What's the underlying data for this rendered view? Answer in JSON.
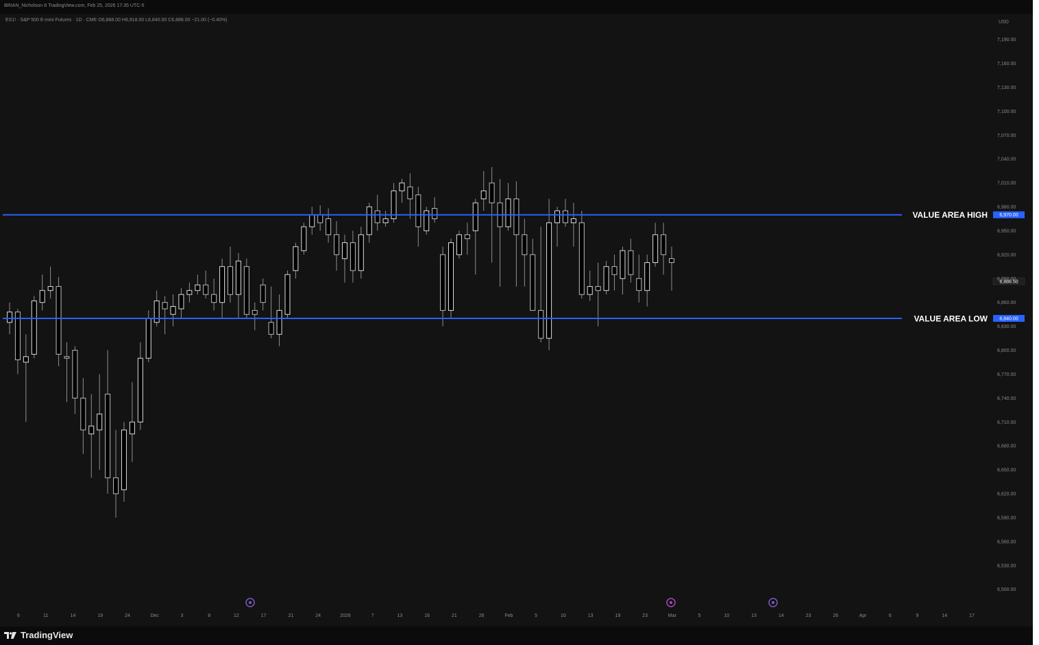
{
  "header": {
    "top_text": "BRIAN_Nicholson·6 TradingView.com, Feb 25, 2026 17:35 UTC-5",
    "legend_text": "ES1! · S&P 500 E-mini Futures · 1D · CME   O6,888.00  H6,918.00  L6,840.00  C6,888.00  −21.00 (−0.40%)"
  },
  "axis": {
    "currency": "USD"
  },
  "levels": [
    {
      "label": "VALUE AREA HIGH",
      "price": 6970.0,
      "tag": "6,970.00",
      "color": "#2962ff"
    },
    {
      "label": "VALUE AREA LOW",
      "price": 6840.0,
      "tag": "6,840.00",
      "color": "#2962ff"
    }
  ],
  "last_price_tag": "6,886.50",
  "markers": [
    {
      "type": "event",
      "x_index": 0,
      "color": "#7e57c2",
      "glyph": "E"
    },
    {
      "type": "event",
      "x_index": 1,
      "color": "#ab47bc",
      "glyph": "D"
    },
    {
      "type": "event",
      "x_index": 2,
      "color": "#7e57c2",
      "glyph": "E"
    }
  ],
  "footer": {
    "brand": "TradingView"
  },
  "chart_data": {
    "type": "candlestick",
    "ylim": [
      6480,
      7200
    ],
    "y_ticks": [
      "7,190.00",
      "7,160.00",
      "7,130.00",
      "7,100.00",
      "7,070.00",
      "7,040.00",
      "7,010.00",
      "6,980.00",
      "6,950.00",
      "6,920.00",
      "6,890.00",
      "6,860.00",
      "6,830.00",
      "6,800.00",
      "6,770.00",
      "6,740.00",
      "6,710.00",
      "6,680.00",
      "6,650.00",
      "6,620.00",
      "6,590.00",
      "6,560.00",
      "6,530.00",
      "6,500.00"
    ],
    "y_tick_values": [
      7190,
      7160,
      7130,
      7100,
      7070,
      7040,
      7010,
      6980,
      6950,
      6920,
      6890,
      6860,
      6830,
      6800,
      6770,
      6740,
      6710,
      6680,
      6650,
      6620,
      6590,
      6560,
      6530,
      6500
    ],
    "x_ticks": [
      "6",
      "11",
      "14",
      "19",
      "24",
      "Dec",
      "3",
      "8",
      "12",
      "17",
      "21",
      "24",
      "2026",
      "7",
      "13",
      "16",
      "21",
      "26",
      "Feb",
      "5",
      "10",
      "13",
      "19",
      "23",
      "Mar",
      "5",
      "10",
      "13",
      "14",
      "23",
      "26",
      "Apr",
      "6",
      "9",
      "14",
      "17"
    ],
    "candles": [
      {
        "o": 6835,
        "h": 6860,
        "l": 6820,
        "c": 6848
      },
      {
        "o": 6848,
        "h": 6852,
        "l": 6770,
        "c": 6788
      },
      {
        "o": 6785,
        "h": 6820,
        "l": 6710,
        "c": 6792
      },
      {
        "o": 6795,
        "h": 6868,
        "l": 6790,
        "c": 6862
      },
      {
        "o": 6860,
        "h": 6895,
        "l": 6850,
        "c": 6875
      },
      {
        "o": 6875,
        "h": 6905,
        "l": 6865,
        "c": 6880
      },
      {
        "o": 6880,
        "h": 6892,
        "l": 6780,
        "c": 6795
      },
      {
        "o": 6792,
        "h": 6810,
        "l": 6735,
        "c": 6790
      },
      {
        "o": 6800,
        "h": 6805,
        "l": 6720,
        "c": 6740
      },
      {
        "o": 6740,
        "h": 6765,
        "l": 6670,
        "c": 6700
      },
      {
        "o": 6695,
        "h": 6745,
        "l": 6640,
        "c": 6705
      },
      {
        "o": 6700,
        "h": 6770,
        "l": 6650,
        "c": 6720
      },
      {
        "o": 6745,
        "h": 6800,
        "l": 6620,
        "c": 6640
      },
      {
        "o": 6640,
        "h": 6700,
        "l": 6590,
        "c": 6620
      },
      {
        "o": 6625,
        "h": 6710,
        "l": 6610,
        "c": 6700
      },
      {
        "o": 6695,
        "h": 6760,
        "l": 6660,
        "c": 6710
      },
      {
        "o": 6710,
        "h": 6810,
        "l": 6700,
        "c": 6790
      },
      {
        "o": 6790,
        "h": 6850,
        "l": 6785,
        "c": 6840
      },
      {
        "o": 6835,
        "h": 6875,
        "l": 6830,
        "c": 6862
      },
      {
        "o": 6860,
        "h": 6868,
        "l": 6820,
        "c": 6852
      },
      {
        "o": 6845,
        "h": 6870,
        "l": 6830,
        "c": 6855
      },
      {
        "o": 6852,
        "h": 6878,
        "l": 6840,
        "c": 6870
      },
      {
        "o": 6870,
        "h": 6885,
        "l": 6860,
        "c": 6875
      },
      {
        "o": 6875,
        "h": 6895,
        "l": 6870,
        "c": 6882
      },
      {
        "o": 6882,
        "h": 6900,
        "l": 6865,
        "c": 6870
      },
      {
        "o": 6870,
        "h": 6890,
        "l": 6850,
        "c": 6860
      },
      {
        "o": 6860,
        "h": 6915,
        "l": 6840,
        "c": 6905
      },
      {
        "o": 6905,
        "h": 6930,
        "l": 6860,
        "c": 6870
      },
      {
        "o": 6870,
        "h": 6922,
        "l": 6840,
        "c": 6912
      },
      {
        "o": 6905,
        "h": 6915,
        "l": 6840,
        "c": 6845
      },
      {
        "o": 6850,
        "h": 6860,
        "l": 6825,
        "c": 6845
      },
      {
        "o": 6882,
        "h": 6890,
        "l": 6850,
        "c": 6860
      },
      {
        "o": 6835,
        "h": 6880,
        "l": 6815,
        "c": 6820
      },
      {
        "o": 6820,
        "h": 6870,
        "l": 6805,
        "c": 6850
      },
      {
        "o": 6845,
        "h": 6900,
        "l": 6840,
        "c": 6895
      },
      {
        "o": 6900,
        "h": 6935,
        "l": 6890,
        "c": 6930
      },
      {
        "o": 6925,
        "h": 6960,
        "l": 6920,
        "c": 6955
      },
      {
        "o": 6955,
        "h": 6980,
        "l": 6945,
        "c": 6970
      },
      {
        "o": 6970,
        "h": 6982,
        "l": 6950,
        "c": 6960
      },
      {
        "o": 6965,
        "h": 6978,
        "l": 6935,
        "c": 6945
      },
      {
        "o": 6945,
        "h": 6962,
        "l": 6900,
        "c": 6920
      },
      {
        "o": 6915,
        "h": 6945,
        "l": 6885,
        "c": 6935
      },
      {
        "o": 6935,
        "h": 6950,
        "l": 6885,
        "c": 6900
      },
      {
        "o": 6900,
        "h": 6955,
        "l": 6890,
        "c": 6945
      },
      {
        "o": 6945,
        "h": 6985,
        "l": 6935,
        "c": 6980
      },
      {
        "o": 6975,
        "h": 6995,
        "l": 6950,
        "c": 6960
      },
      {
        "o": 6960,
        "h": 6975,
        "l": 6955,
        "c": 6965
      },
      {
        "o": 6965,
        "h": 7010,
        "l": 6960,
        "c": 7000
      },
      {
        "o": 7000,
        "h": 7015,
        "l": 6985,
        "c": 7010
      },
      {
        "o": 7005,
        "h": 7022,
        "l": 6965,
        "c": 6990
      },
      {
        "o": 6995,
        "h": 7005,
        "l": 6930,
        "c": 6955
      },
      {
        "o": 6950,
        "h": 6980,
        "l": 6945,
        "c": 6975
      },
      {
        "o": 6978,
        "h": 6992,
        "l": 6960,
        "c": 6965
      },
      {
        "o": 6920,
        "h": 6930,
        "l": 6830,
        "c": 6850
      },
      {
        "o": 6850,
        "h": 6940,
        "l": 6840,
        "c": 6935
      },
      {
        "o": 6920,
        "h": 6950,
        "l": 6915,
        "c": 6945
      },
      {
        "o": 6945,
        "h": 6960,
        "l": 6920,
        "c": 6940
      },
      {
        "o": 6950,
        "h": 6990,
        "l": 6895,
        "c": 6985
      },
      {
        "o": 6990,
        "h": 7025,
        "l": 6975,
        "c": 7000
      },
      {
        "o": 7010,
        "h": 7030,
        "l": 6910,
        "c": 6985
      },
      {
        "o": 6985,
        "h": 7015,
        "l": 6880,
        "c": 6955
      },
      {
        "o": 6955,
        "h": 7010,
        "l": 6950,
        "c": 6990
      },
      {
        "o": 6990,
        "h": 7012,
        "l": 6880,
        "c": 6945
      },
      {
        "o": 6945,
        "h": 6965,
        "l": 6880,
        "c": 6920
      },
      {
        "o": 6920,
        "h": 6940,
        "l": 6860,
        "c": 6850
      },
      {
        "o": 6850,
        "h": 6955,
        "l": 6810,
        "c": 6815
      },
      {
        "o": 6815,
        "h": 6990,
        "l": 6800,
        "c": 6960
      },
      {
        "o": 6960,
        "h": 6980,
        "l": 6930,
        "c": 6975
      },
      {
        "o": 6975,
        "h": 6990,
        "l": 6955,
        "c": 6960
      },
      {
        "o": 6960,
        "h": 6985,
        "l": 6930,
        "c": 6965
      },
      {
        "o": 6960,
        "h": 6975,
        "l": 6865,
        "c": 6870
      },
      {
        "o": 6870,
        "h": 6900,
        "l": 6862,
        "c": 6880
      },
      {
        "o": 6880,
        "h": 6910,
        "l": 6830,
        "c": 6875
      },
      {
        "o": 6875,
        "h": 6912,
        "l": 6870,
        "c": 6905
      },
      {
        "o": 6905,
        "h": 6920,
        "l": 6875,
        "c": 6895
      },
      {
        "o": 6890,
        "h": 6930,
        "l": 6870,
        "c": 6925
      },
      {
        "o": 6925,
        "h": 6940,
        "l": 6885,
        "c": 6895
      },
      {
        "o": 6890,
        "h": 6920,
        "l": 6860,
        "c": 6875
      },
      {
        "o": 6875,
        "h": 6920,
        "l": 6855,
        "c": 6910
      },
      {
        "o": 6910,
        "h": 6960,
        "l": 6905,
        "c": 6945
      },
      {
        "o": 6945,
        "h": 6960,
        "l": 6895,
        "c": 6920
      },
      {
        "o": 6915,
        "h": 6930,
        "l": 6875,
        "c": 6910
      }
    ]
  }
}
